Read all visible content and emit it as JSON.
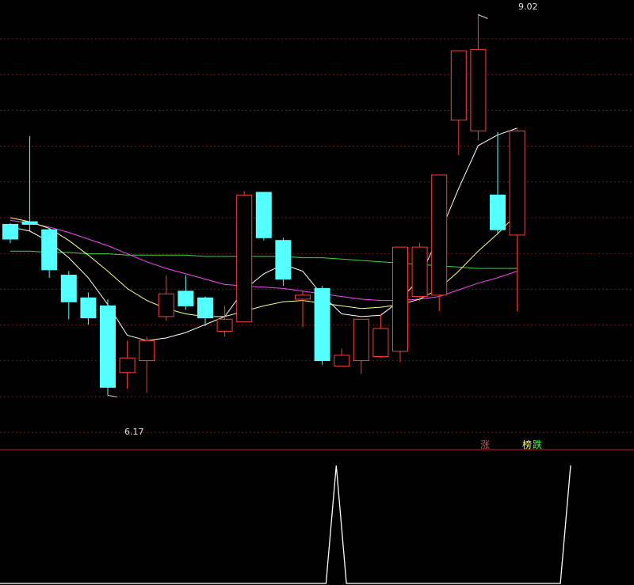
{
  "colors": {
    "background": "#000000",
    "up_candle": "#ff3b3b",
    "down_candle": "#54ffff",
    "grid": "#7a1c1c",
    "ma_fast": "#ffffff",
    "ma_mid": "#ffff88",
    "ma_slow": "#ff44ff",
    "ma_long": "#33dd33",
    "signal": "#ffffff",
    "separator": "#cc2222"
  },
  "chart_data": [
    {
      "type": "candlestick",
      "ylim": [
        5.9,
        9.1
      ],
      "grid": true,
      "max_label": "9.02",
      "min_label": "6.17",
      "candles": [
        {
          "open": 7.45,
          "close": 7.34,
          "high": 7.46,
          "low": 7.31
        },
        {
          "open": 7.47,
          "close": 7.45,
          "high": 8.11,
          "low": 7.4
        },
        {
          "open": 7.41,
          "close": 7.11,
          "high": 7.42,
          "low": 7.05
        },
        {
          "open": 7.07,
          "close": 6.87,
          "high": 7.1,
          "low": 6.74
        },
        {
          "open": 6.9,
          "close": 6.75,
          "high": 6.94,
          "low": 6.7
        },
        {
          "open": 6.84,
          "close": 6.23,
          "high": 6.89,
          "low": 6.17
        },
        {
          "open": 6.34,
          "close": 6.45,
          "high": 6.58,
          "low": 6.22
        },
        {
          "open": 6.43,
          "close": 6.58,
          "high": 6.61,
          "low": 6.19
        },
        {
          "open": 6.76,
          "close": 6.93,
          "high": 7.07,
          "low": 6.73
        },
        {
          "open": 6.95,
          "close": 6.84,
          "high": 7.07,
          "low": 6.81
        },
        {
          "open": 6.9,
          "close": 6.75,
          "high": 6.91,
          "low": 6.69
        },
        {
          "open": 6.65,
          "close": 6.74,
          "high": 6.84,
          "low": 6.61
        },
        {
          "open": 6.72,
          "close": 7.67,
          "high": 7.7,
          "low": 6.72
        },
        {
          "open": 7.69,
          "close": 7.35,
          "high": 7.69,
          "low": 7.33
        },
        {
          "open": 7.33,
          "close": 7.04,
          "high": 7.35,
          "low": 6.99
        },
        {
          "open": 6.89,
          "close": 6.92,
          "high": 6.95,
          "low": 6.68
        },
        {
          "open": 6.97,
          "close": 6.43,
          "high": 6.99,
          "low": 6.4
        },
        {
          "open": 6.39,
          "close": 6.47,
          "high": 6.52,
          "low": 6.39
        },
        {
          "open": 6.43,
          "close": 6.74,
          "high": 6.74,
          "low": 6.33
        },
        {
          "open": 6.46,
          "close": 6.67,
          "high": 6.78,
          "low": 6.45
        },
        {
          "open": 6.5,
          "close": 7.28,
          "high": 7.28,
          "low": 6.42
        },
        {
          "open": 6.91,
          "close": 7.28,
          "high": 7.31,
          "low": 6.88
        },
        {
          "open": 6.92,
          "close": 7.82,
          "high": 7.82,
          "low": 6.8
        },
        {
          "open": 8.23,
          "close": 8.75,
          "high": 8.75,
          "low": 7.97
        },
        {
          "open": 8.15,
          "close": 8.76,
          "high": 9.02,
          "low": 8.08
        },
        {
          "open": 7.67,
          "close": 7.41,
          "high": 8.14,
          "low": 7.38
        },
        {
          "open": 7.37,
          "close": 8.15,
          "high": 8.16,
          "low": 6.8
        }
      ],
      "ma_fast": [
        7.43,
        7.4,
        7.32,
        7.2,
        7.05,
        6.85,
        6.62,
        6.58,
        6.6,
        6.64,
        6.7,
        6.76,
        6.96,
        7.08,
        7.15,
        7.1,
        6.92,
        6.78,
        6.76,
        6.77,
        6.88,
        7.05,
        7.37,
        7.72,
        8.04,
        8.12,
        8.17
      ],
      "ma_mid": [
        7.5,
        7.47,
        7.42,
        7.33,
        7.22,
        7.1,
        6.97,
        6.88,
        6.82,
        6.78,
        6.76,
        6.76,
        6.8,
        6.84,
        6.87,
        6.88,
        6.86,
        6.84,
        6.82,
        6.83,
        6.85,
        6.89,
        6.97,
        7.1,
        7.25,
        7.38,
        7.53
      ],
      "ma_slow": [
        7.48,
        7.46,
        7.43,
        7.39,
        7.34,
        7.29,
        7.23,
        7.17,
        7.12,
        7.08,
        7.04,
        7.0,
        6.99,
        6.98,
        6.97,
        6.95,
        6.93,
        6.91,
        6.89,
        6.88,
        6.88,
        6.89,
        6.91,
        6.96,
        7.01,
        7.05,
        7.1
      ],
      "ma_long": [
        7.25,
        7.25,
        7.24,
        7.24,
        7.23,
        7.23,
        7.22,
        7.22,
        7.22,
        7.22,
        7.21,
        7.21,
        7.21,
        7.21,
        7.21,
        7.2,
        7.2,
        7.19,
        7.18,
        7.17,
        7.16,
        7.15,
        7.14,
        7.13,
        7.12,
        7.12,
        7.12
      ]
    },
    {
      "type": "line",
      "ylim": [
        0,
        1
      ],
      "legend": [
        "涨",
        "榜",
        "跌"
      ],
      "series": [
        {
          "values": [
            0,
            0,
            0,
            0,
            0,
            0,
            0,
            0,
            0,
            0,
            0,
            0,
            0,
            0,
            0,
            0,
            0,
            0,
            0,
            0,
            0,
            0,
            0,
            0,
            0,
            0,
            0,
            0,
            0,
            0,
            0,
            0,
            0,
            1,
            0,
            0,
            0,
            0,
            0,
            0,
            0,
            0,
            0,
            0,
            0,
            0,
            0,
            0,
            0,
            0,
            0,
            0,
            0,
            0,
            0,
            0,
            1
          ]
        }
      ]
    }
  ]
}
